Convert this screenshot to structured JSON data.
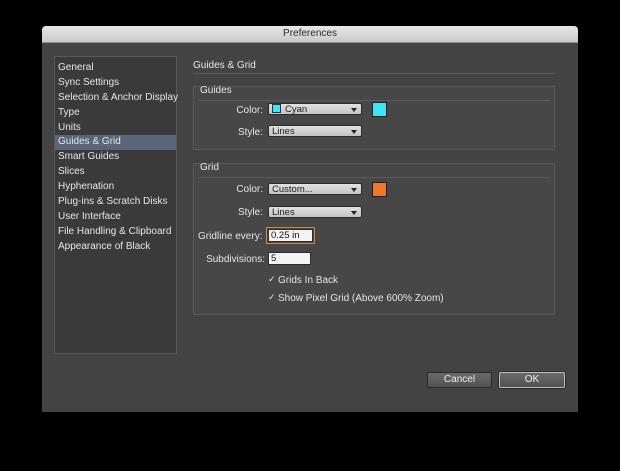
{
  "window": {
    "title": "Preferences"
  },
  "sidebar": {
    "items": [
      {
        "label": "General"
      },
      {
        "label": "Sync Settings"
      },
      {
        "label": "Selection & Anchor Display"
      },
      {
        "label": "Type"
      },
      {
        "label": "Units"
      },
      {
        "label": "Guides & Grid",
        "selected": true
      },
      {
        "label": "Smart Guides"
      },
      {
        "label": "Slices"
      },
      {
        "label": "Hyphenation"
      },
      {
        "label": "Plug-ins & Scratch Disks"
      },
      {
        "label": "User Interface"
      },
      {
        "label": "File Handling & Clipboard"
      },
      {
        "label": "Appearance of Black"
      }
    ]
  },
  "main": {
    "section_title": "Guides & Grid",
    "guides": {
      "title": "Guides",
      "color_label": "Color:",
      "color_value": "Cyan",
      "color_hex": "#3fe6f2",
      "style_label": "Style:",
      "style_value": "Lines"
    },
    "grid": {
      "title": "Grid",
      "color_label": "Color:",
      "color_value": "Custom...",
      "color_hex": "#f07a2c",
      "style_label": "Style:",
      "style_value": "Lines",
      "gridline_label": "Gridline every:",
      "gridline_value": "0.25",
      "gridline_unit": "in",
      "subdivisions_label": "Subdivisions:",
      "subdivisions_value": "5",
      "grids_in_back_label": "Grids In Back",
      "grids_in_back_checked": true,
      "show_pixel_grid_label": "Show Pixel Grid (Above 600% Zoom)",
      "show_pixel_grid_checked": true
    }
  },
  "buttons": {
    "cancel": "Cancel",
    "ok": "OK"
  }
}
